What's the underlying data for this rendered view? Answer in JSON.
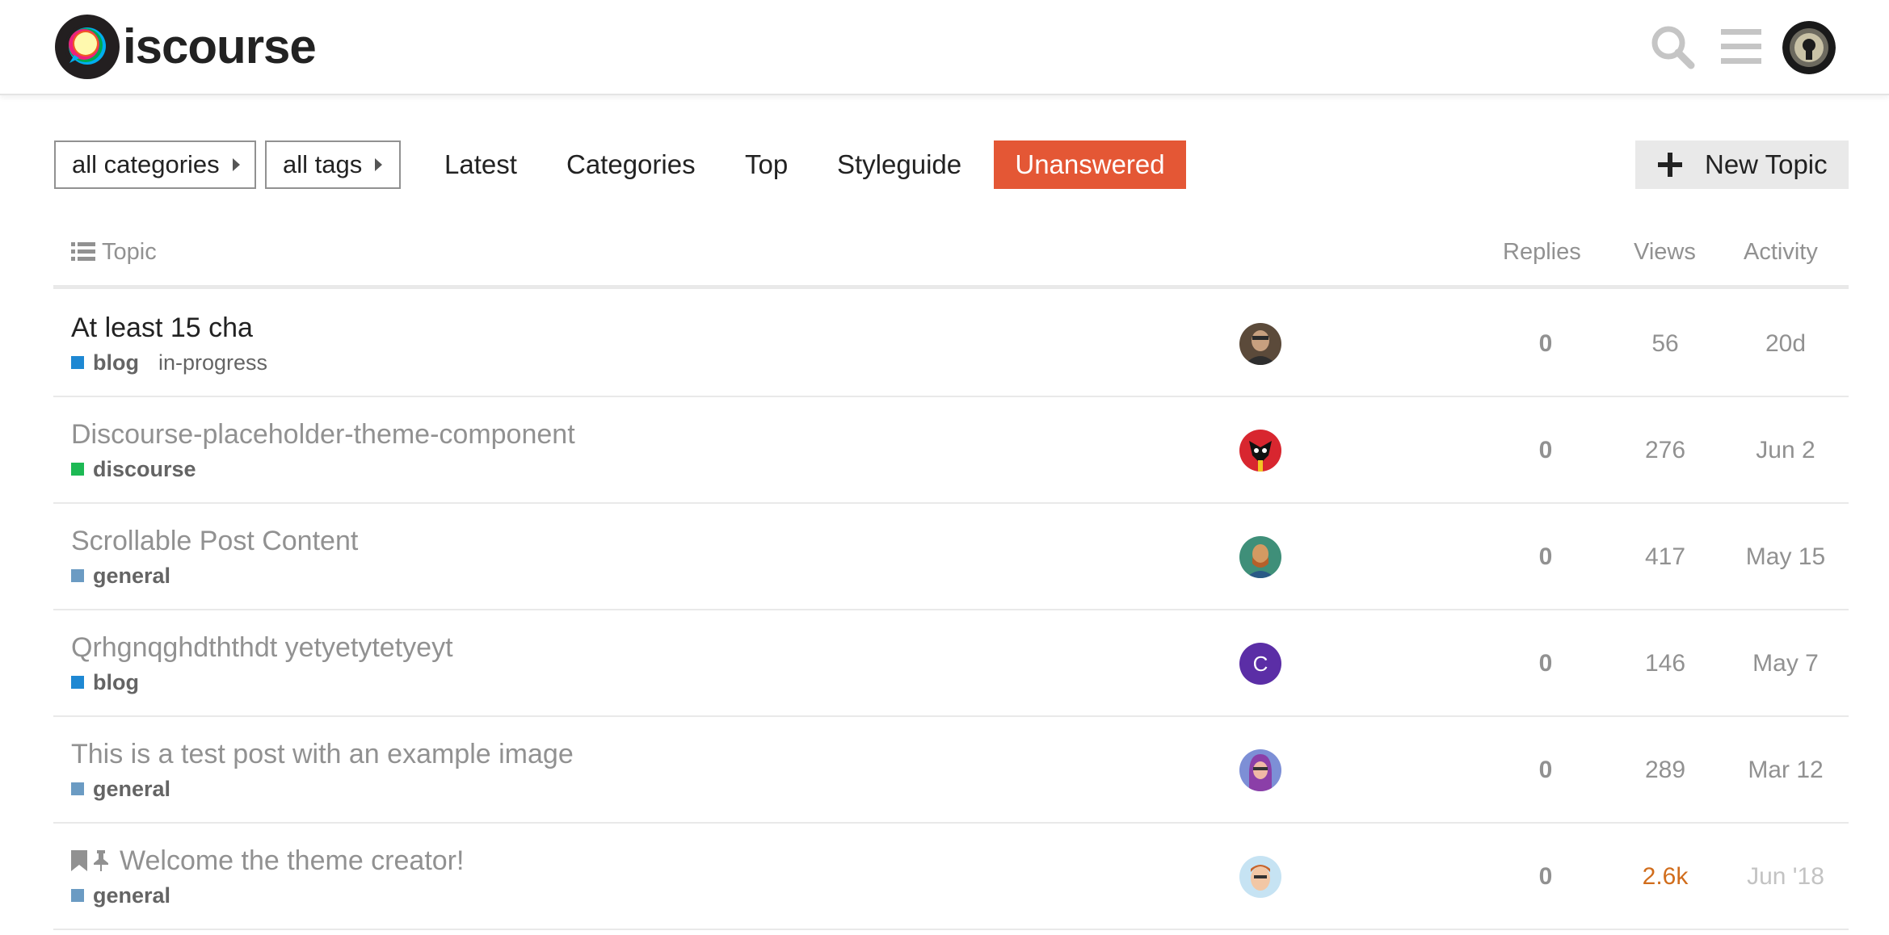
{
  "header": {
    "logo_text": "iscourse",
    "search_icon": "search-icon",
    "menu_icon": "hamburger-icon",
    "avatar_icon": "user-avatar"
  },
  "nav": {
    "categories_dropdown": "all categories",
    "tags_dropdown": "all tags",
    "links": [
      "Latest",
      "Categories",
      "Top",
      "Styleguide",
      "Unanswered"
    ],
    "active": "Unanswered",
    "new_topic": "New Topic",
    "accent_color": "#e45735"
  },
  "table": {
    "headers": {
      "topic": "Topic",
      "replies": "Replies",
      "views": "Views",
      "activity": "Activity"
    },
    "rows": [
      {
        "title": "At least 15 cha",
        "category": "blog",
        "category_color": "#1e88d3",
        "tag": "in-progress",
        "replies": "0",
        "views": "56",
        "activity": "20d",
        "unread": true
      },
      {
        "title": "Discourse-placeholder-theme-component",
        "category": "discourse",
        "category_color": "#1db954",
        "replies": "0",
        "views": "276",
        "activity": "Jun 2"
      },
      {
        "title": "Scrollable Post Content",
        "category": "general",
        "category_color": "#6b9bc3",
        "replies": "0",
        "views": "417",
        "activity": "May 15"
      },
      {
        "title": "Qrhgnqghdththdt yetyetytetyeyt",
        "category": "blog",
        "category_color": "#1e88d3",
        "replies": "0",
        "views": "146",
        "activity": "May 7",
        "avatar_letter": "C"
      },
      {
        "title": "This is a test post with an example image",
        "category": "general",
        "category_color": "#6b9bc3",
        "replies": "0",
        "views": "289",
        "activity": "Mar 12"
      },
      {
        "title": "Welcome the theme creator!",
        "category": "general",
        "category_color": "#6b9bc3",
        "replies": "0",
        "views": "2.6k",
        "activity": "Jun '18",
        "pinned": true,
        "views_hot": true
      }
    ]
  }
}
